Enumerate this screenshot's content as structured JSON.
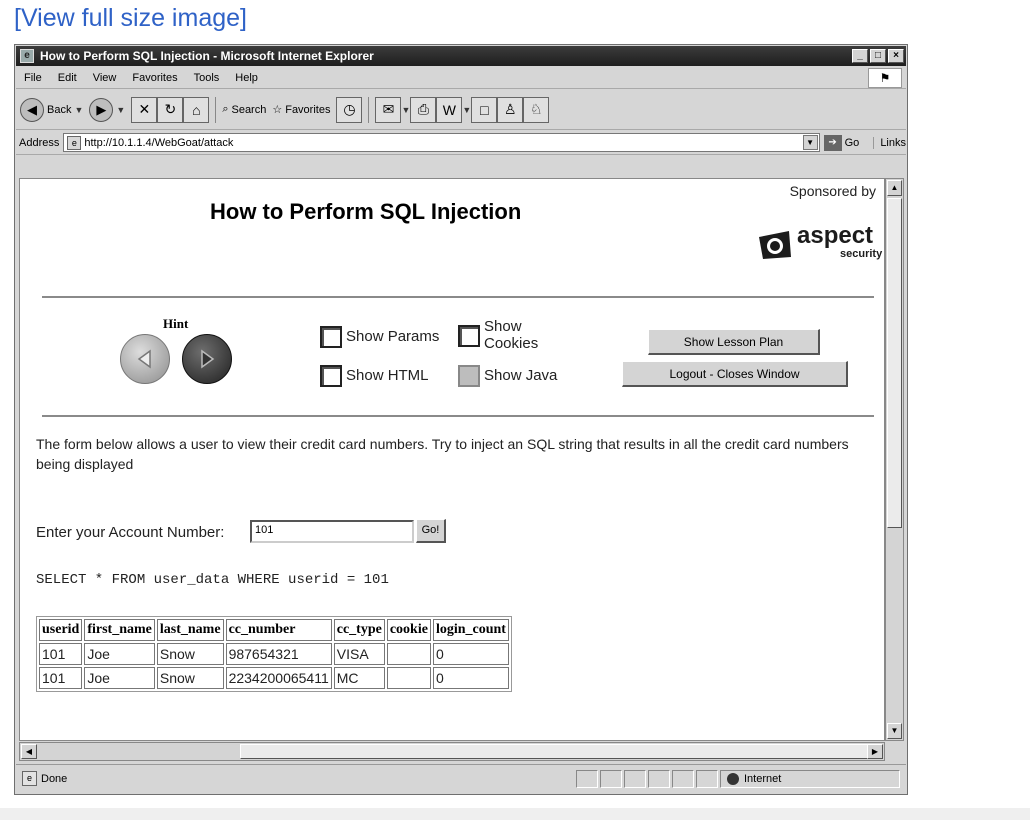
{
  "top_link": "[View full size image]",
  "window": {
    "title": "How to Perform SQL Injection - Microsoft Internet Explorer",
    "controls": [
      "_",
      "□",
      "×"
    ]
  },
  "menu": [
    "File",
    "Edit",
    "View",
    "Favorites",
    "Tools",
    "Help"
  ],
  "toolbar": {
    "back": "Back",
    "search": "Search",
    "favorites": "Favorites"
  },
  "address": {
    "label": "Address",
    "url": "http://10.1.1.4/WebGoat/attack",
    "go": "Go",
    "links": "Links"
  },
  "status": {
    "text": "Done",
    "zone": "Internet"
  },
  "page": {
    "sponsored_by": "Sponsored by",
    "title": "How to Perform SQL Injection",
    "logo_text": "aspect",
    "logo_sub": "security",
    "hint": "Hint",
    "show_params": "Show Params",
    "show_cookies": "Show Cookies",
    "show_html": "Show HTML",
    "show_java": "Show Java",
    "show_lesson_plan": "Show Lesson Plan",
    "logout": "Logout - Closes Window",
    "description": "The form below allows a user to view their credit card numbers. Try to inject an SQL string that results in all the credit card numbers being displayed",
    "account_label": "Enter your Account Number:",
    "account_value": "101",
    "go_button": "Go!",
    "sql": "SELECT * FROM user_data WHERE userid = 101",
    "table": {
      "headers": [
        "userid",
        "first_name",
        "last_name",
        "cc_number",
        "cc_type",
        "cookie",
        "login_count"
      ],
      "rows": [
        [
          "101",
          "Joe",
          "Snow",
          "987654321",
          "VISA",
          "",
          "0"
        ],
        [
          "101",
          "Joe",
          "Snow",
          "2234200065411",
          "MC",
          "",
          "0"
        ]
      ]
    }
  }
}
